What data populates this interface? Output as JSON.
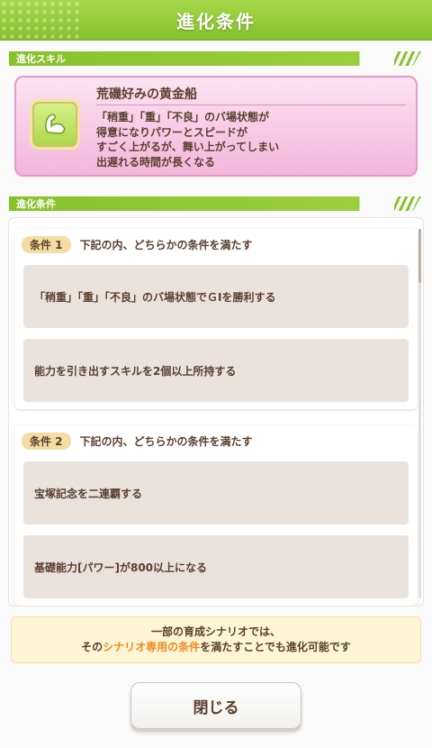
{
  "header": {
    "title": "進化条件"
  },
  "evolution_skill_section": {
    "label": "進化スキル"
  },
  "skill": {
    "icon": "flexed-arm-icon",
    "name": "荒磯好みの黄金船",
    "description": "「稍重」「重」「不良」のバ場状態が\n得意になりパワーとスピードが\nすごく上がるが、舞い上がってしまい\n出遅れる時間が長くなる"
  },
  "evolution_conditions_section": {
    "label": "進化条件"
  },
  "conditions": [
    {
      "badge": "条件 1",
      "title": "下記の内、どちらかの条件を満たす",
      "items": [
        "「稍重」「重」「不良」のバ場状態でＧⅠを勝利する",
        "能力を引き出すスキルを2個以上所持する"
      ]
    },
    {
      "badge": "条件 2",
      "title": "下記の内、どちらかの条件を満たす",
      "items": [
        "宝塚記念を二連覇する",
        "基礎能力[パワー]が800以上になる"
      ]
    }
  ],
  "notice": {
    "line1": "一部の育成シナリオでは、",
    "line2_prefix": "その",
    "line2_highlight": "シナリオ専用の条件",
    "line2_suffix": "を満たすことでも進化可能です"
  },
  "close_button": {
    "label": "閉じる"
  },
  "colors": {
    "header_green": "#86c12c",
    "skill_pink": "#f4b6dc",
    "badge_yellow": "#f5dca2",
    "highlight_orange": "#f08a1e",
    "text_brown": "#5a3f2c"
  }
}
